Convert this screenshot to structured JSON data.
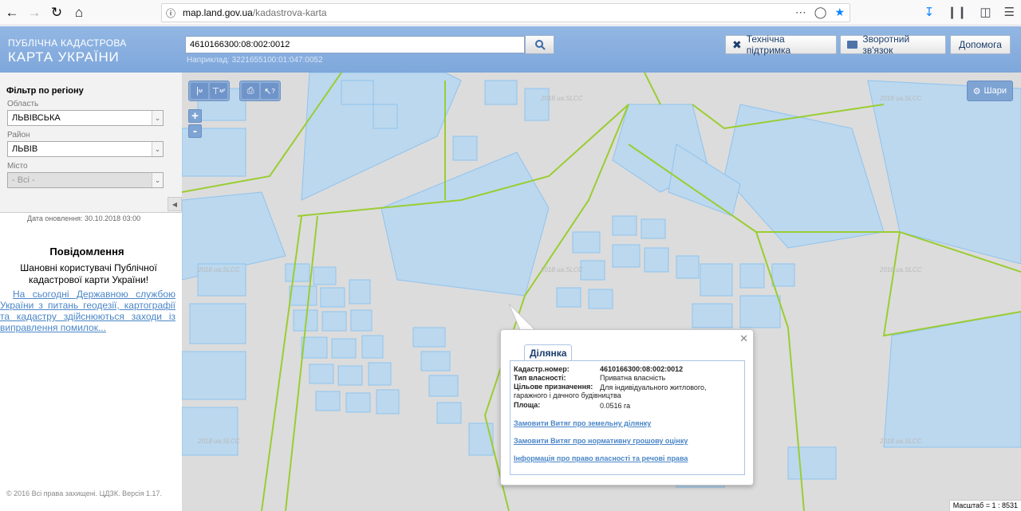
{
  "browser": {
    "url_domain": "map.land.gov.ua",
    "url_path": "/kadastrova-karta"
  },
  "header": {
    "logo_top": "ПУБЛІЧНА КАДАСТРОВА",
    "logo_bottom": "КАРТА УКРАЇНИ",
    "search_value": "4610166300:08:002:0012",
    "search_hint": "Наприклад: 3221655100:01:047:0052",
    "support_label": "Технічна підтримка",
    "feedback_label": "Зворотний зв'язок",
    "help_label": "Допомога"
  },
  "sidebar": {
    "filter_title": "Фільтр по регіону",
    "region_label": "Область",
    "region_value": "ЛЬВІВСЬКА",
    "district_label": "Район",
    "district_value": "ЛЬВІВ",
    "city_label": "Місто",
    "city_value": "- Всі -",
    "update_date": "Дата оновлення: 30.10.2018 03:00",
    "notice_title": "Повідомлення",
    "notice_greeting": "Шановні користувачі Публічної кадастрової карти України!",
    "notice_link": "На сьогодні Державною службою України з питань геодезії, картографії та кадастру здійснюються заходи із виправлення помилок...",
    "copyright": "© 2016 Всі права захищені. ЦДЗК. Версія 1.17."
  },
  "map": {
    "tool_labels": [
      "м",
      "м²",
      "",
      "?"
    ],
    "zoom_in": "+",
    "zoom_out": "-",
    "layers_label": "Шари",
    "scale": "Масштаб = 1 : 8531",
    "watermark": "2018 ua.SLCC"
  },
  "popup": {
    "tab_label": "Ділянка",
    "cadastral_label": "Кадастр.номер:",
    "cadastral_value": "4610166300:08:002:0012",
    "ownership_label": "Тип власності:",
    "ownership_value": "Приватна власність",
    "purpose_label": "Цільове призначення:",
    "purpose_value_1": "Для індивідуального житлового,",
    "purpose_value_2": "гаражного і дачного будівництва",
    "area_label": "Площа:",
    "area_value": "0.0516 га",
    "link_extract": "Замовити Витяг про земельну ділянку",
    "link_valuation": "Замовити Витяг про нормативну грошову оцінку",
    "link_rights": "Інформація про право власності та речові права"
  },
  "colors": {
    "header_bg": "#7ea7db",
    "parcel_fill": "#bcd8ee",
    "parcel_stroke": "#8ec3ef",
    "boundary": "#9acd32",
    "link": "#4a86c8"
  }
}
